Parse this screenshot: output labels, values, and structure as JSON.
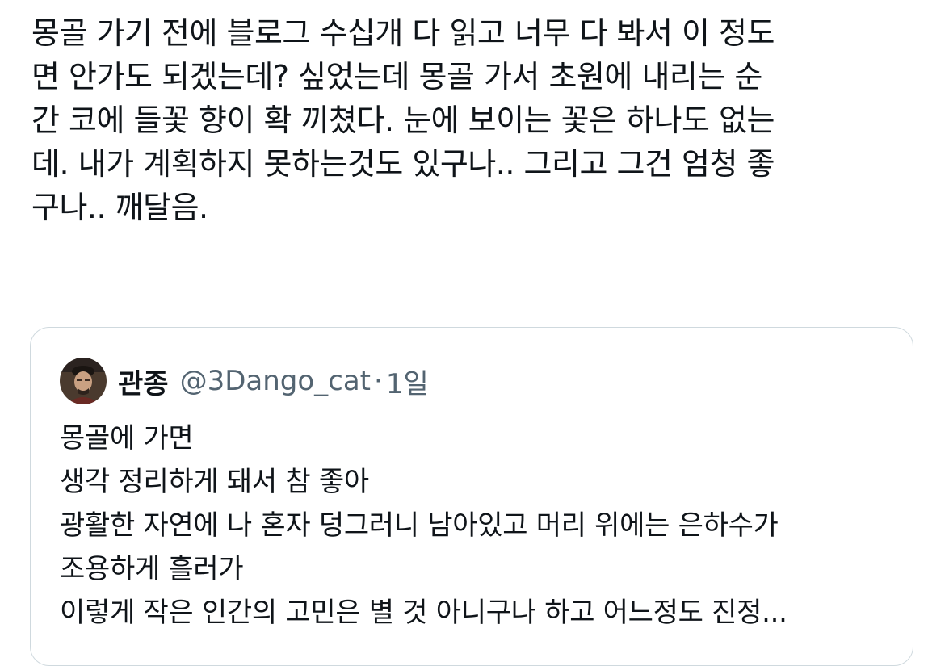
{
  "tweet": {
    "text": "몽골 가기 전에 블로그 수십개 다 읽고 너무 다 봐서 이 정도\n면 안가도 되겠는데? 싶었는데 몽골 가서 초원에 내리는 순\n간 코에 들꽃 향이 확 끼쳤다. 눈에 보이는 꽃은 하나도 없는\n데. 내가 계획하지 못하는것도 있구나..  그리고 그건 엄청 좋\n구나.. 깨달음."
  },
  "quoted_tweet": {
    "author_name": "관종",
    "author_handle": "@3Dango_cat",
    "separator": "·",
    "time": "1일",
    "avatar_icon": "profile-photo",
    "text": "몽골에 가면\n생각 정리하게 돼서 참 좋아\n광활한 자연에 나 혼자 덩그러니 남아있고 머리 위에는 은하수가\n조용하게 흘러가\n이렇게 작은 인간의 고민은 별 것 아니구나 하고 어느정도 진정..."
  },
  "colors": {
    "text_primary": "#0f1419",
    "text_secondary": "#536471",
    "border": "#cfd9de",
    "background": "#ffffff"
  }
}
